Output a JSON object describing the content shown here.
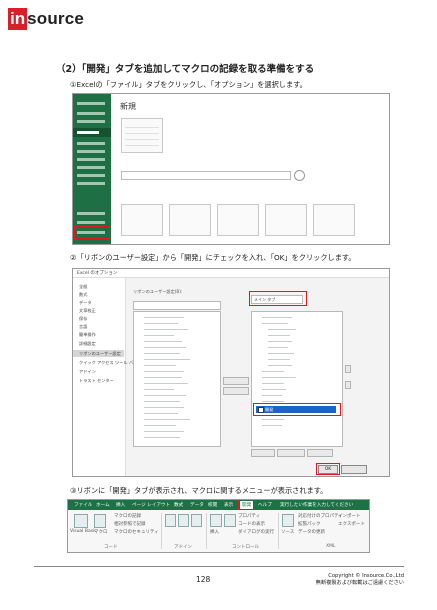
{
  "logo": {
    "red_letter": "in",
    "rest": "source"
  },
  "heading": "（2）「開発」タブを追加してマクロの記録を取る準備をする",
  "steps": [
    "①Excelの「ファイル」タブをクリックし、「オプション」を選択します。",
    "②「リボンのユーザー設定」から「開発」にチェックを入れ、「OK」をクリックします。",
    "③リボンに「開発」タブが表示され、マクロに関するメニューが表示されます。"
  ],
  "screenshot1": {
    "panel_title": "新規"
  },
  "screenshot2": {
    "window_title": "Excel のオプション",
    "nav": [
      "全般",
      "数式",
      "データ",
      "文章校正",
      "保存",
      "言語",
      "簡単操作",
      "詳細設定",
      "リボンのユーザー設定",
      "クイック アクセス ツール バー",
      "アドイン",
      "トラスト センター"
    ],
    "nav_selected_index": 8,
    "combo_label": "リボンのユーザー設定(B):",
    "right_combo": "メイン タブ",
    "highlight_item": "開発",
    "ok_label": "OK"
  },
  "screenshot3": {
    "tabs": [
      "ファイル",
      "ホーム",
      "挿入",
      "ページ レイアウト",
      "数式",
      "データ",
      "校閲",
      "表示",
      "開発",
      "ヘルプ",
      "実行したい作業を入力してください"
    ],
    "active_tab_index": 8,
    "group_labels": [
      "コード",
      "アドイン",
      "コントロール",
      "XML"
    ],
    "buttons": [
      "Visual Basic",
      "マクロ",
      "マクロの記録",
      "相対参照で記録",
      "マクロのセキュリティ",
      "アドイン",
      "Excel アドイン",
      "COM アドイン",
      "挿入",
      "デザイン モード",
      "プロパティ",
      "コードの表示",
      "ダイアログの実行",
      "ソース",
      "対応付けのプロパティ",
      "拡張パック",
      "データの更新",
      "インポート",
      "エクスポート"
    ]
  },
  "footer": {
    "page": "128",
    "copyright": "Copyright © Insource.Co.,Ltd",
    "notice": "無断複製および転載はご遠慮ください"
  },
  "colors": {
    "brand_red": "#d9202a",
    "excel_green": "#1e7145",
    "highlight": "#e0191f"
  }
}
